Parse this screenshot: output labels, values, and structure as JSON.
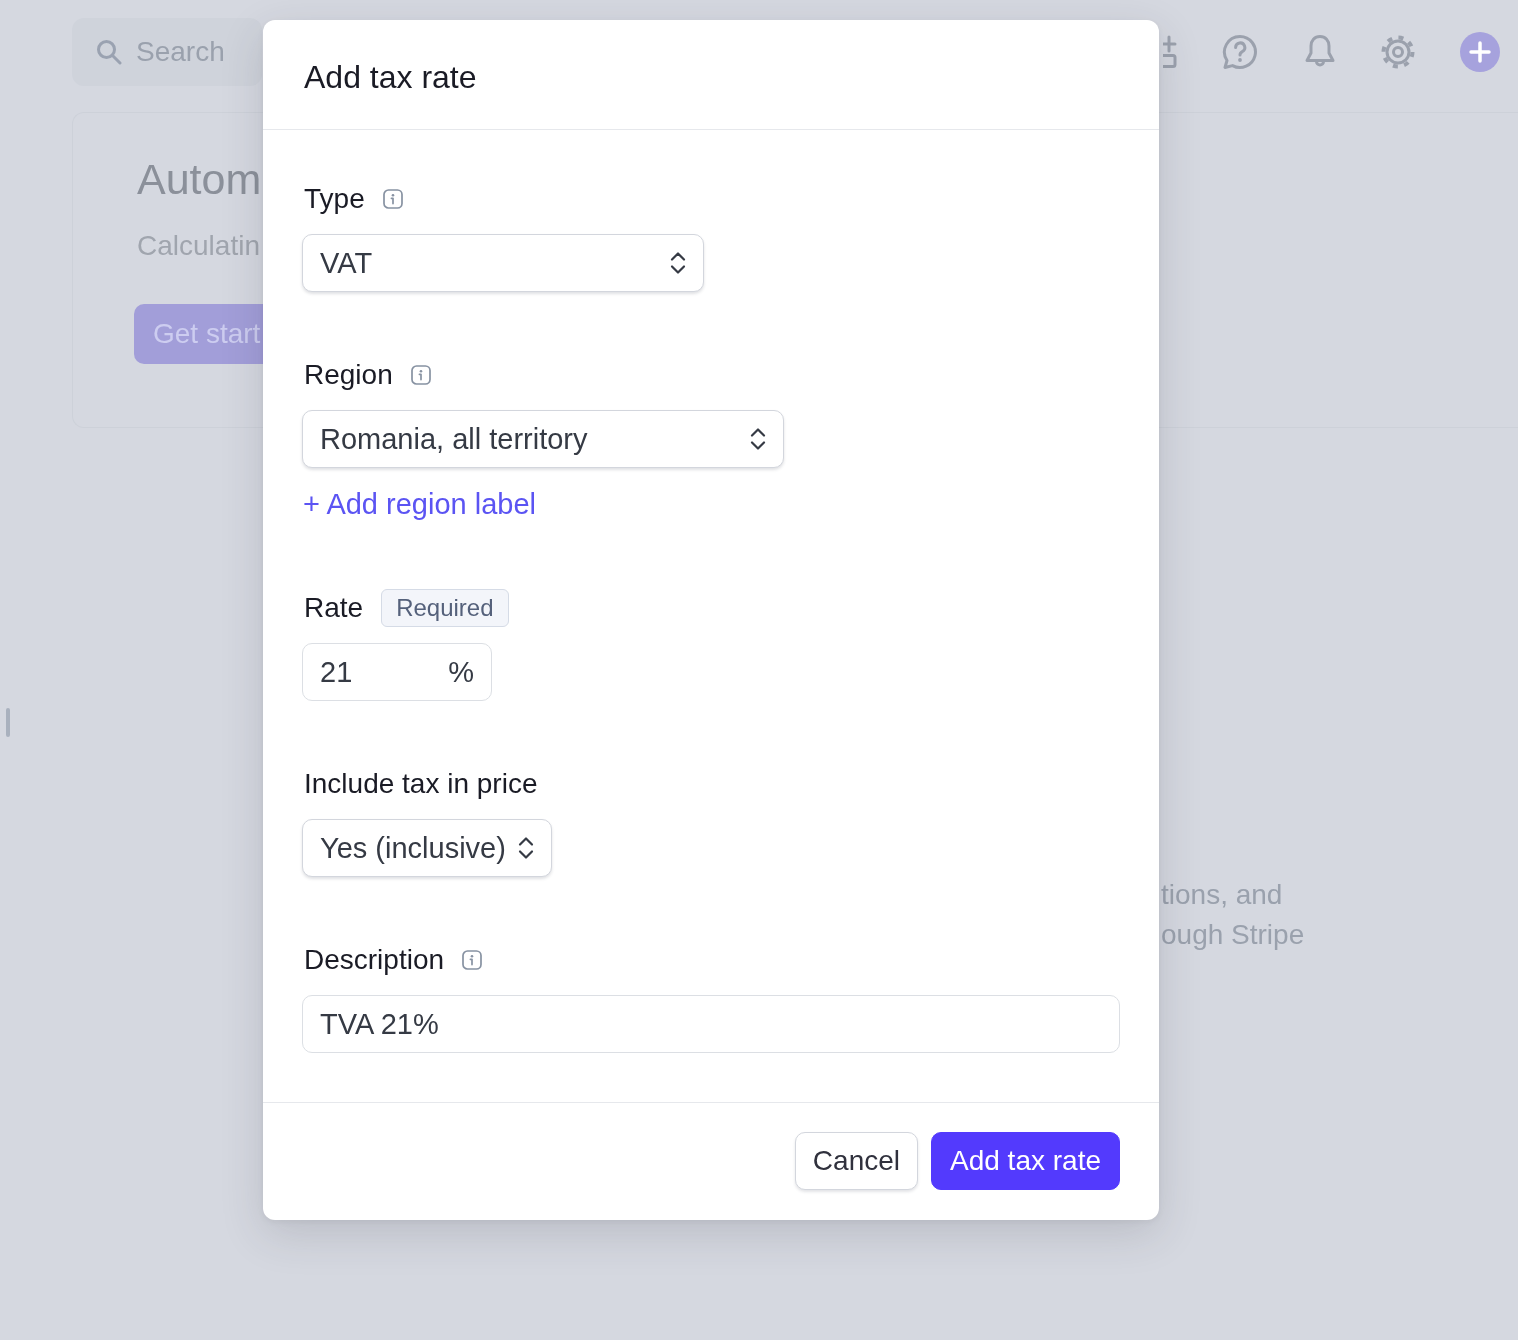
{
  "page": {
    "search": {
      "placeholder": "Search"
    },
    "card": {
      "title": "Autom",
      "subtitle": "Calculatin",
      "button": "Get start"
    },
    "note_lines": [
      "tions, and",
      "ough Stripe"
    ]
  },
  "dialog": {
    "title": "Add tax rate",
    "fields": [
      {
        "kind": "select",
        "label": "Type",
        "info": true,
        "value": "VAT"
      },
      {
        "kind": "select",
        "label": "Region",
        "info": true,
        "value": "Romania, all territory",
        "link": "+ Add region label"
      },
      {
        "kind": "input",
        "label": "Rate",
        "info": false,
        "badge": "Required",
        "value": "21",
        "suffix": "%"
      },
      {
        "kind": "select",
        "label": "Include tax in price",
        "info": false,
        "value": "Yes (inclusive)"
      },
      {
        "kind": "input",
        "label": "Description",
        "info": true,
        "value": "TVA 21%"
      }
    ],
    "buttons": [
      {
        "kind": "secondary",
        "label": "Cancel"
      },
      {
        "kind": "primary",
        "label": "Add tax rate"
      }
    ]
  }
}
